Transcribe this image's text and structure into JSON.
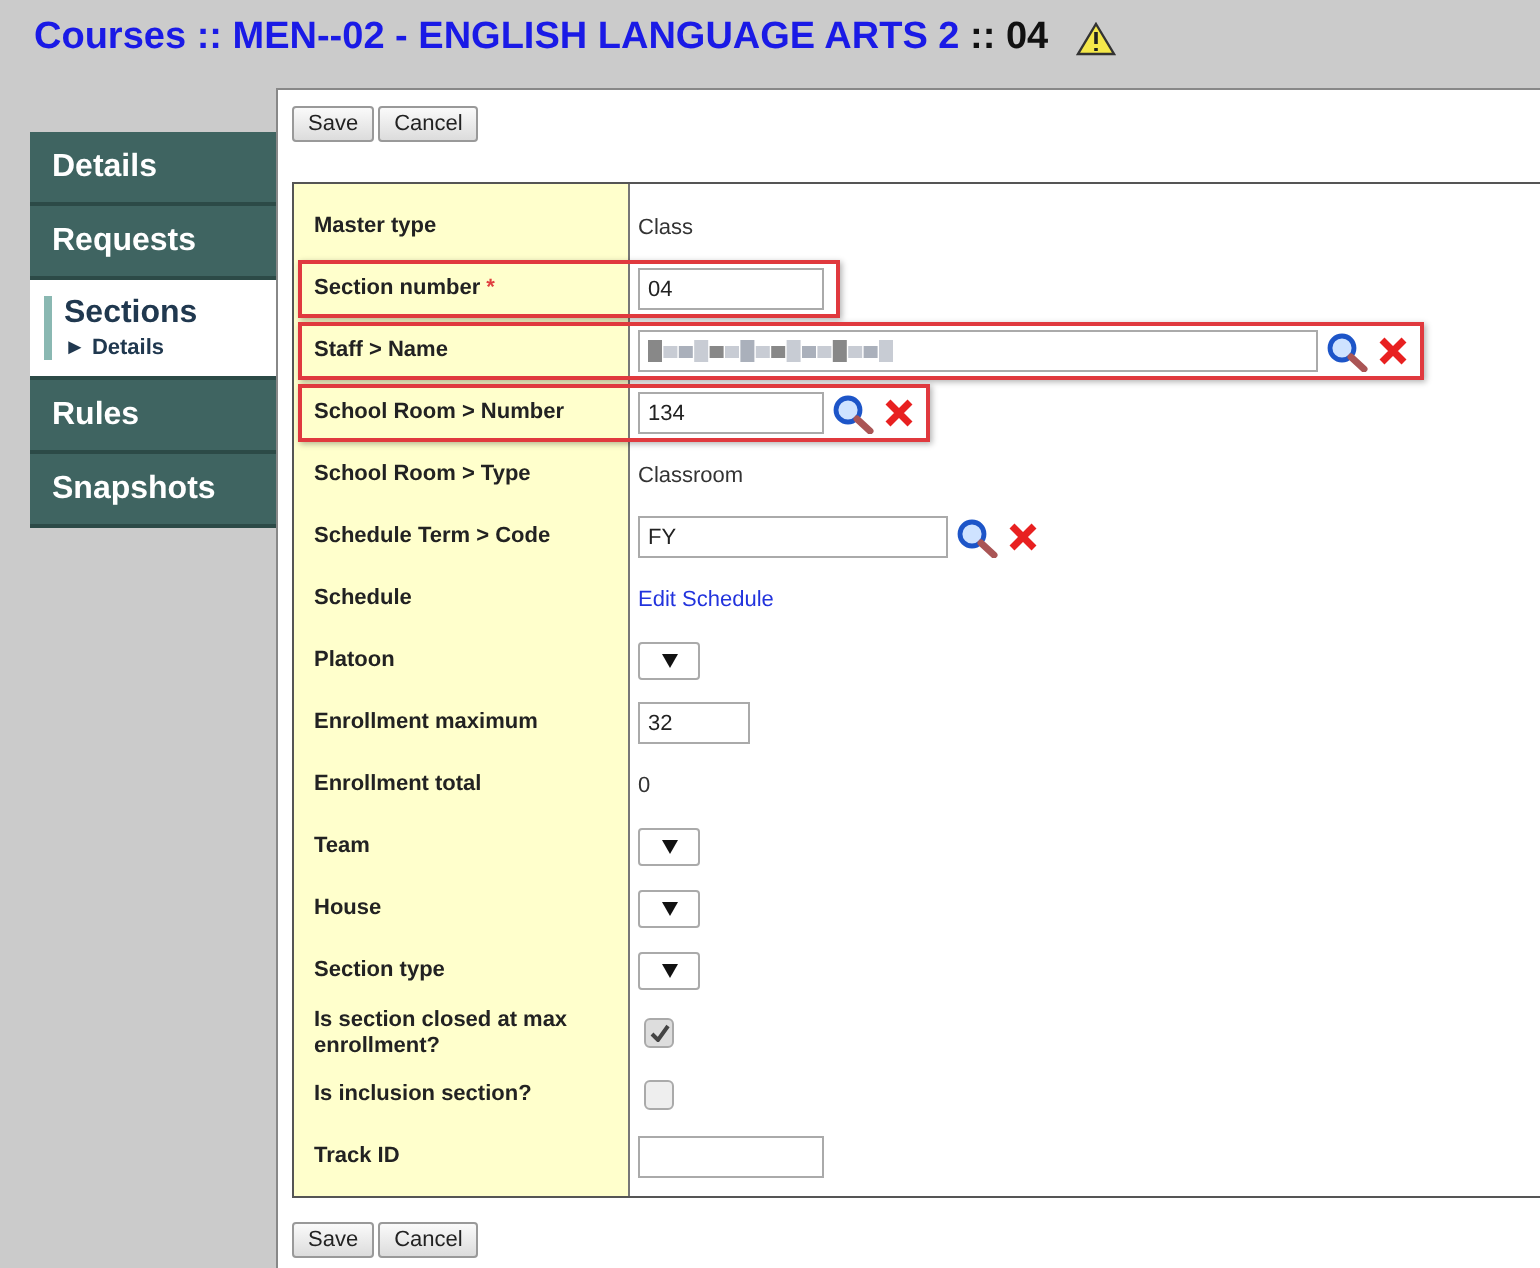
{
  "title": {
    "prefix": "Courses",
    "separator_1": "::",
    "course": "MEN--02 - ENGLISH LANGUAGE ARTS 2",
    "separator_2": "::",
    "section": "04"
  },
  "sidebar": {
    "items": [
      {
        "label": "Details",
        "selected": false
      },
      {
        "label": "Requests",
        "selected": false
      },
      {
        "label": "Sections",
        "selected": true,
        "sub_marker": "►",
        "sub": "Details"
      },
      {
        "label": "Rules",
        "selected": false
      },
      {
        "label": "Snapshots",
        "selected": false
      }
    ]
  },
  "top_buttons": [
    "Save",
    "Cancel"
  ],
  "rows": [
    {
      "kind": "text",
      "label": "Master type",
      "value": "Class",
      "highlighted": false
    },
    {
      "kind": "input",
      "label": "Section number",
      "required_mark": "*",
      "value": "04",
      "highlighted": true
    },
    {
      "kind": "redacted-lookup",
      "label": "Staff > Name",
      "highlighted": true
    },
    {
      "kind": "lookup",
      "label": "School Room > Number",
      "value": "134",
      "highlighted": true
    },
    {
      "kind": "text",
      "label": "School Room > Type",
      "value": "Classroom",
      "highlighted": false
    },
    {
      "kind": "lookup",
      "label": "Schedule Term > Code",
      "value": "FY",
      "highlighted": false
    },
    {
      "kind": "link",
      "label": "Schedule",
      "value": "Edit Schedule",
      "highlighted": false
    },
    {
      "kind": "select",
      "label": "Platoon",
      "highlighted": false
    },
    {
      "kind": "input",
      "label": "Enrollment maximum",
      "value": "32",
      "highlighted": false
    },
    {
      "kind": "text",
      "label": "Enrollment total",
      "value": "0",
      "highlighted": false
    },
    {
      "kind": "select",
      "label": "Team",
      "highlighted": false
    },
    {
      "kind": "select",
      "label": "House",
      "highlighted": false
    },
    {
      "kind": "select",
      "label": "Section type",
      "highlighted": false
    },
    {
      "kind": "checkbox",
      "label": "Is section closed at max enrollment?",
      "checked": true,
      "highlighted": false
    },
    {
      "kind": "checkbox",
      "label": "Is inclusion section?",
      "checked": false,
      "highlighted": false
    },
    {
      "kind": "input",
      "label": "Track ID",
      "value": "",
      "highlighted": false
    }
  ],
  "bottom_buttons": [
    "Save",
    "Cancel"
  ]
}
